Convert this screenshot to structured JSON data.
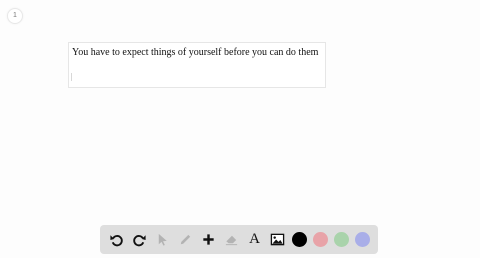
{
  "page": {
    "badge": "1"
  },
  "canvas": {
    "text": "You have to expect things of yourself before you can do them"
  },
  "toolbar": {
    "tools": [
      {
        "name": "undo-icon"
      },
      {
        "name": "redo-icon"
      },
      {
        "name": "select-pointer-icon"
      },
      {
        "name": "pencil-icon"
      },
      {
        "name": "add-plus-icon"
      },
      {
        "name": "eraser-icon"
      },
      {
        "name": "text-tool-icon",
        "glyph": "A"
      },
      {
        "name": "image-icon"
      }
    ],
    "colors": [
      "#000000",
      "#e8a3a8",
      "#a9d3ab",
      "#a9aee8"
    ]
  }
}
